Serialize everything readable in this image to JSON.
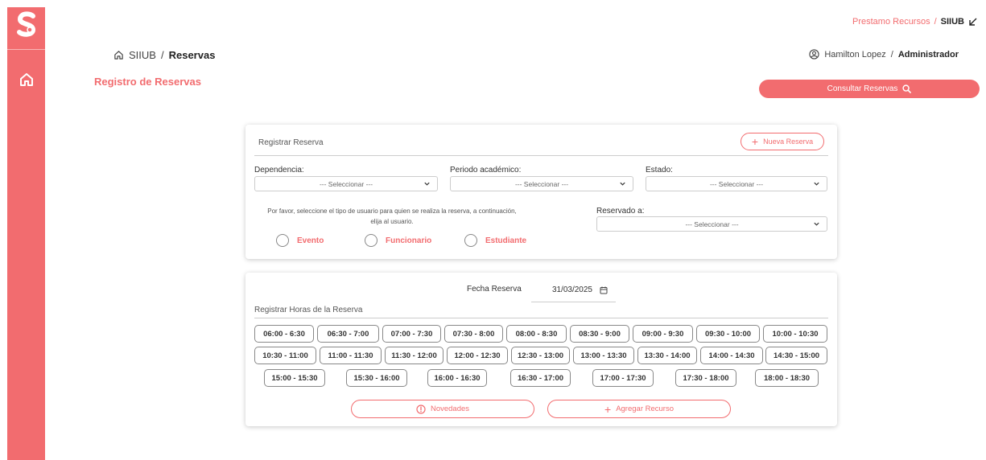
{
  "app": {
    "logo": "S-logo-icon",
    "accent": "#f26c6f"
  },
  "topbar": {
    "module": "Prestamo Recursos",
    "separator": "/",
    "system": "SIIUB",
    "collapse_icon": "arrow-down-left-icon"
  },
  "breadcrumb": {
    "root": "SIIUB",
    "separator": "/",
    "current": "Reservas"
  },
  "user": {
    "name": "Hamilton Lopez",
    "separator": "/",
    "role": "Administrador"
  },
  "page": {
    "title": "Registro de Reservas"
  },
  "consult_button": {
    "label": "Consultar Reservas"
  },
  "registrar": {
    "title": "Registrar Reserva",
    "new_button": "Nueva Reserva",
    "dependencia": {
      "label": "Dependencia:",
      "value": "--- Seleccionar ---"
    },
    "periodo": {
      "label": "Periodo académico:",
      "value": "--- Seleccionar ---"
    },
    "estado": {
      "label": "Estado:",
      "value": "--- Seleccionar ---"
    },
    "hint_line1": "Por favor, seleccione el tipo de usuario para quien se realiza la reserva, a continuación,",
    "hint_line2": "elija al usuario.",
    "user_types": [
      "Evento",
      "Funcionario",
      "Estudiante"
    ],
    "reservado": {
      "label": "Reservado a:",
      "value": "--- Seleccionar ---"
    }
  },
  "horas": {
    "fecha_label": "Fecha Reserva",
    "fecha_value": "31/03/2025",
    "title": "Registrar Horas de la Reserva",
    "slots": [
      "06:00 - 6:30",
      "06:30 - 7:00",
      "07:00 - 7:30",
      "07:30 - 8:00",
      "08:00 - 8:30",
      "08:30 - 9:00",
      "09:00 - 9:30",
      "09:30 - 10:00",
      "10:00 - 10:30",
      "10:30 - 11:00",
      "11:00 - 11:30",
      "11:30 - 12:00",
      "12:00 - 12:30",
      "12:30 - 13:00",
      "13:00 - 13:30",
      "13:30 - 14:00",
      "14:00 - 14:30",
      "14:30 - 15:00",
      "15:00 - 15:30",
      "15:30 - 16:00",
      "16:00 - 16:30",
      "16:30 - 17:00",
      "17:00 - 17:30",
      "17:30 - 18:00",
      "18:00 - 18:30"
    ],
    "novedades_button": "Novedades",
    "agregar_button": "Agregar Recurso"
  }
}
